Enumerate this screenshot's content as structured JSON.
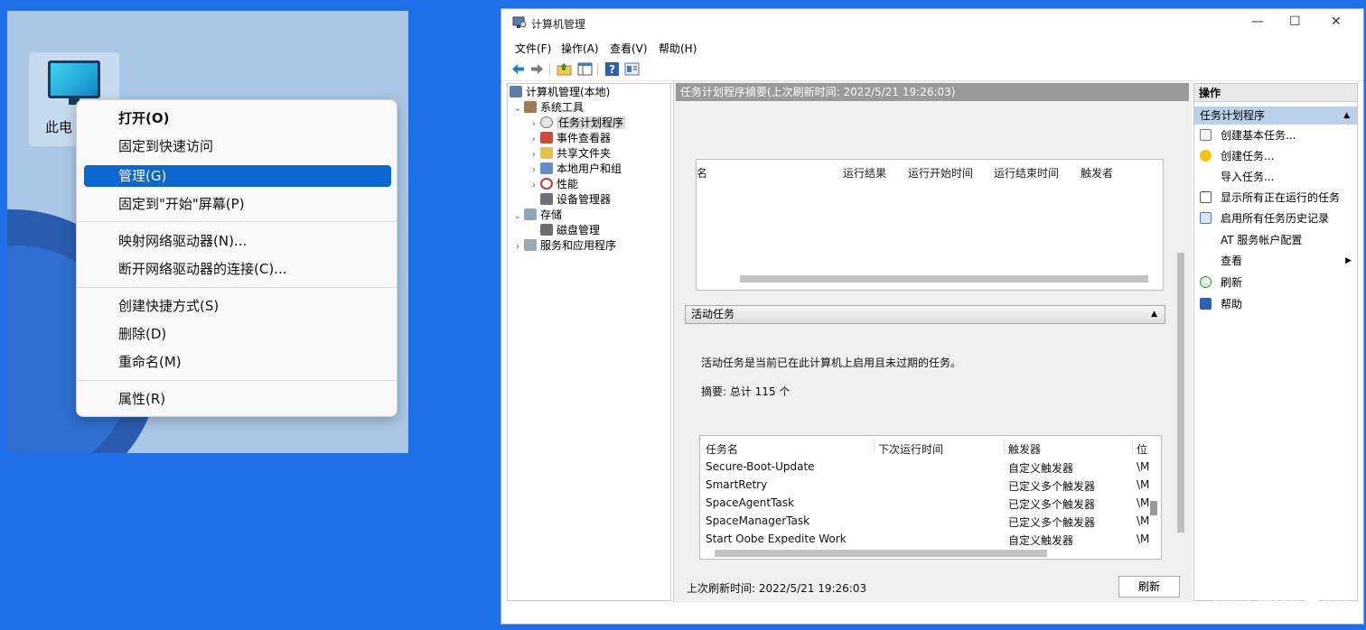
{
  "desktop": {
    "icon_label": "此电",
    "context_menu": [
      "打开(O)",
      "固定到快速访问",
      "管理(G)",
      "固定到\"开始\"屏幕(P)",
      "映射网络驱动器(N)...",
      "断开网络驱动器的连接(C)...",
      "创建快捷方式(S)",
      "删除(D)",
      "重命名(M)",
      "属性(R)"
    ]
  },
  "window": {
    "title": "计算机管理",
    "controls": [
      "—",
      "☐",
      "✕"
    ],
    "menu": [
      "文件(F)",
      "操作(A)",
      "查看(V)",
      "帮助(H)"
    ],
    "toolbar_icons": [
      "back-arrow-icon",
      "forward-arrow-icon",
      "up-folder-icon",
      "show-hide-tree-icon",
      "help-icon",
      "properties-icon"
    ]
  },
  "tree": {
    "root": "计算机管理(本地)",
    "system_tools": "系统工具",
    "task_scheduler": "任务计划程序",
    "event_viewer": "事件查看器",
    "shared_folders": "共享文件夹",
    "local_users": "本地用户和组",
    "performance": "性能",
    "device_manager": "设备管理器",
    "storage": "存储",
    "disk_management": "磁盘管理",
    "services_apps": "服务和应用程序"
  },
  "center": {
    "header": "任务计划程序摘要(上次刷新时间: 2022/5/21 19:26:03)",
    "table1_headers": [
      "运行结果",
      "运行开始时间",
      "运行结束时间",
      "触发者"
    ],
    "table1_cut": "名",
    "section_title": "活动任务",
    "description": "活动任务是当前已在此计算机上启用且未过期的任务。",
    "summary": "摘要: 总计 115 个",
    "table2_headers": [
      "任务名",
      "下次运行时间",
      "触发器",
      "位"
    ],
    "table2_rows": [
      {
        "name": "Secure-Boot-Update",
        "trigger": "自定义触发器",
        "loc": "\\M"
      },
      {
        "name": "SmartRetry",
        "trigger": "已定义多个触发器",
        "loc": "\\M"
      },
      {
        "name": "SpaceAgentTask",
        "trigger": "已定义多个触发器",
        "loc": "\\M"
      },
      {
        "name": "SpaceManagerTask",
        "trigger": "已定义多个触发器",
        "loc": "\\M"
      },
      {
        "name": "Start Oobe Expedite Work",
        "trigger": "自定义触发器",
        "loc": "\\M"
      }
    ],
    "last_refresh": "上次刷新时间: 2022/5/21 19:26:03",
    "refresh_button": "刷新"
  },
  "actions": {
    "header": "操作",
    "sub_header": "任务计划程序",
    "items": [
      "创建基本任务...",
      "创建任务...",
      "导入任务...",
      "显示所有正在运行的任务",
      "启用所有任务历史记录",
      "AT 服务帐户配置",
      "查看",
      "刷新",
      "帮助"
    ]
  },
  "watermark": "@稀土掘金技术社区"
}
